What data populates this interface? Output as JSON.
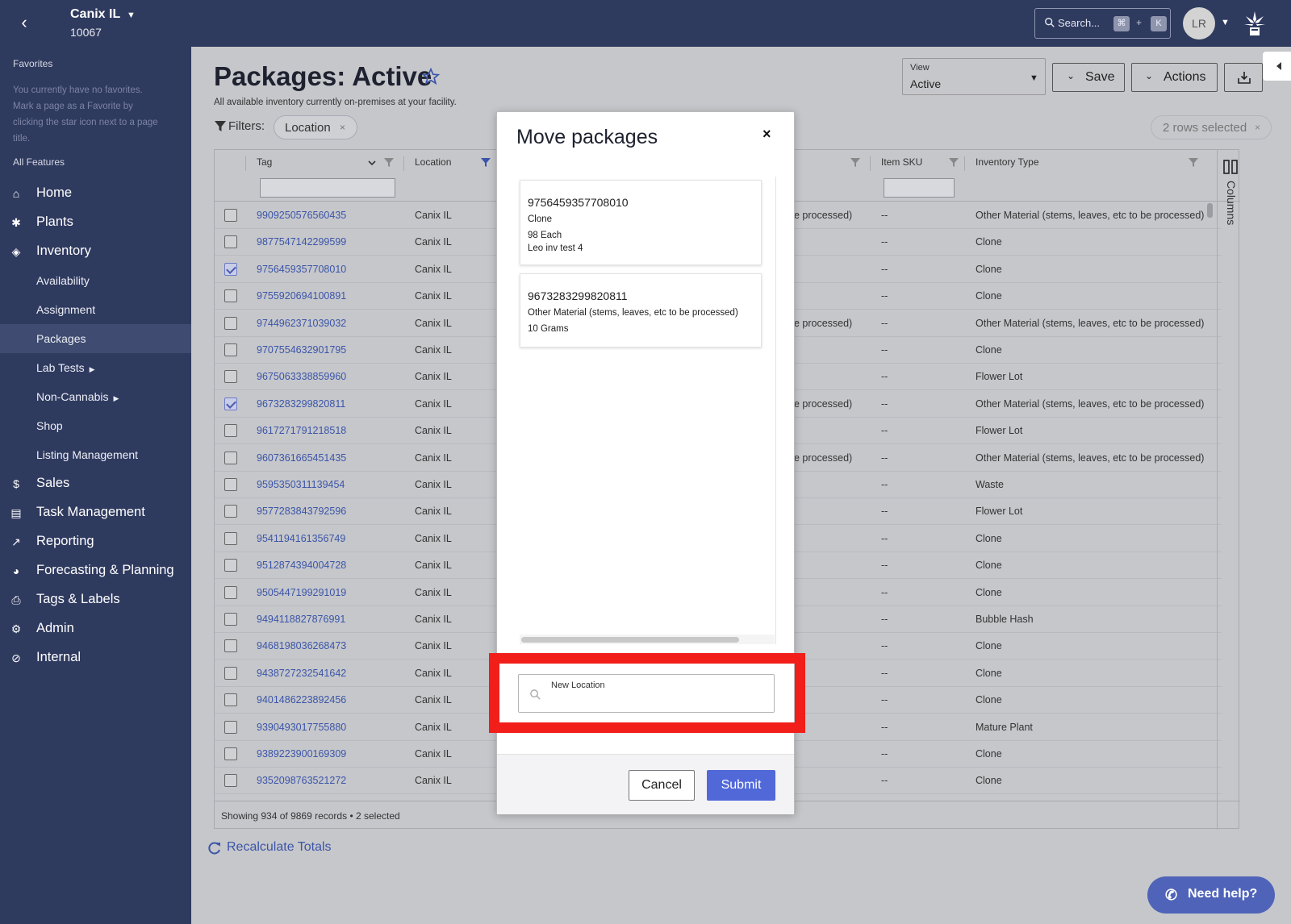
{
  "topbar": {
    "facility_name": "Canix IL",
    "facility_id": "10067",
    "search_placeholder": "Search...",
    "shortcut_cmd": "⌘",
    "shortcut_plus": "+",
    "shortcut_key": "K",
    "avatar_initials": "LR"
  },
  "sidebar": {
    "favorites_title": "Favorites",
    "favorites_note": "You currently have no favorites. Mark a page as a Favorite by clicking the star icon next to a page title.",
    "all_features": "All Features",
    "items": {
      "home": "Home",
      "plants": "Plants",
      "inventory": "Inventory",
      "availability": "Availability",
      "assignment": "Assignment",
      "packages": "Packages",
      "lab_tests": "Lab Tests",
      "non_cannabis": "Non-Cannabis",
      "shop": "Shop",
      "listing_management": "Listing Management",
      "sales": "Sales",
      "task_management": "Task Management",
      "reporting": "Reporting",
      "forecasting": "Forecasting & Planning",
      "tags_labels": "Tags & Labels",
      "admin": "Admin",
      "internal": "Internal"
    }
  },
  "page": {
    "title": "Packages: Active",
    "subtitle": "All available inventory currently on-premises at your facility.",
    "filters_label": "Filters:",
    "filter_chip": "Location",
    "filter_chip_x": "×",
    "view_label": "View",
    "view_value": "Active",
    "save_label": "Save",
    "actions_label": "Actions",
    "rows_selected": "2 rows selected",
    "rows_selected_x": "×"
  },
  "grid": {
    "columns": {
      "tag": "Tag",
      "location": "Location",
      "item_sku": "Item SKU",
      "inventory_type": "Inventory Type"
    },
    "rows": [
      {
        "tag": "9909250576560435",
        "location": "Canix IL",
        "extra": "be processed)",
        "sku": "--",
        "type": "Other Material (stems, leaves, etc to be processed)",
        "checked": false
      },
      {
        "tag": "9877547142299599",
        "location": "Canix IL",
        "extra": "",
        "sku": "--",
        "type": "Clone",
        "checked": false
      },
      {
        "tag": "9756459357708010",
        "location": "Canix IL",
        "extra": "",
        "sku": "--",
        "type": "Clone",
        "checked": true
      },
      {
        "tag": "9755920694100891",
        "location": "Canix IL",
        "extra": "",
        "sku": "--",
        "type": "Clone",
        "checked": false
      },
      {
        "tag": "9744962371039032",
        "location": "Canix IL",
        "extra": "be processed)",
        "sku": "--",
        "type": "Other Material (stems, leaves, etc to be processed)",
        "checked": false
      },
      {
        "tag": "9707554632901795",
        "location": "Canix IL",
        "extra": "",
        "sku": "--",
        "type": "Clone",
        "checked": false
      },
      {
        "tag": "9675063338859960",
        "location": "Canix IL",
        "extra": "",
        "sku": "--",
        "type": "Flower Lot",
        "checked": false
      },
      {
        "tag": "9673283299820811",
        "location": "Canix IL",
        "extra": "be processed)",
        "sku": "--",
        "type": "Other Material (stems, leaves, etc to be processed)",
        "checked": true
      },
      {
        "tag": "9617271791218518",
        "location": "Canix IL",
        "extra": "",
        "sku": "--",
        "type": "Flower Lot",
        "checked": false
      },
      {
        "tag": "9607361665451435",
        "location": "Canix IL",
        "extra": "be processed)",
        "sku": "--",
        "type": "Other Material (stems, leaves, etc to be processed)",
        "checked": false
      },
      {
        "tag": "9595350311139454",
        "location": "Canix IL",
        "extra": "",
        "sku": "--",
        "type": "Waste",
        "checked": false
      },
      {
        "tag": "9577283843792596",
        "location": "Canix IL",
        "extra": "",
        "sku": "--",
        "type": "Flower Lot",
        "checked": false
      },
      {
        "tag": "9541194161356749",
        "location": "Canix IL",
        "extra": "",
        "sku": "--",
        "type": "Clone",
        "checked": false
      },
      {
        "tag": "9512874394004728",
        "location": "Canix IL",
        "extra": "",
        "sku": "--",
        "type": "Clone",
        "checked": false
      },
      {
        "tag": "9505447199291019",
        "location": "Canix IL",
        "extra": "",
        "sku": "--",
        "type": "Clone",
        "checked": false
      },
      {
        "tag": "9494118827876991",
        "location": "Canix IL",
        "extra": "",
        "sku": "--",
        "type": "Bubble Hash",
        "checked": false
      },
      {
        "tag": "9468198036268473",
        "location": "Canix IL",
        "extra": "",
        "sku": "--",
        "type": "Clone",
        "checked": false
      },
      {
        "tag": "9438727232541642",
        "location": "Canix IL",
        "extra": "",
        "sku": "--",
        "type": "Clone",
        "checked": false
      },
      {
        "tag": "9401486223892456",
        "location": "Canix IL",
        "extra": "",
        "sku": "--",
        "type": "Clone",
        "checked": false
      },
      {
        "tag": "9390493017755880",
        "location": "Canix IL",
        "extra": "",
        "sku": "--",
        "type": "Mature Plant",
        "checked": false
      },
      {
        "tag": "9389223900169309",
        "location": "Canix IL",
        "extra": "",
        "sku": "--",
        "type": "Clone",
        "checked": false
      },
      {
        "tag": "9352098763521272",
        "location": "Canix IL",
        "extra": "",
        "sku": "--",
        "type": "Clone",
        "checked": false
      }
    ],
    "footer": "Showing 934 of 9869 records • 2 selected",
    "columns_panel": "Columns"
  },
  "recalculate_label": "Recalculate Totals",
  "help_label": "Need help?",
  "modal": {
    "title": "Move packages",
    "close": "×",
    "packages": [
      {
        "tag": "9756459357708010",
        "type": "Clone",
        "qty": "98 Each",
        "note": "Leo inv test 4"
      },
      {
        "tag": "9673283299820811",
        "type": "Other Material (stems, leaves, etc to be processed)",
        "qty": "10 Grams",
        "note": ""
      }
    ],
    "new_location_label": "New Location",
    "cancel_label": "Cancel",
    "submit_label": "Submit"
  },
  "colors": {
    "navy": "#2f3a5f",
    "link": "#3b55a8",
    "submit": "#5168d9",
    "highlight": "#f11e1a"
  }
}
